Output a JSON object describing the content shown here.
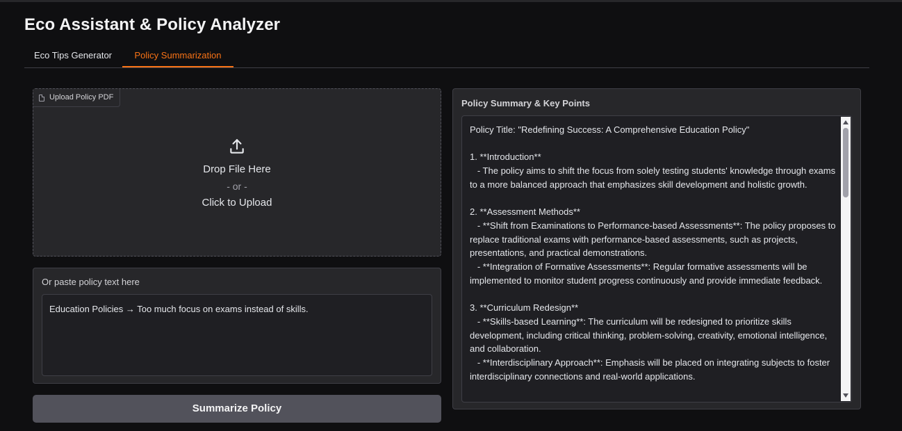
{
  "app": {
    "title": "Eco Assistant & Policy Analyzer"
  },
  "tabs": [
    {
      "label": "Eco Tips Generator",
      "active": false
    },
    {
      "label": "Policy Summarization",
      "active": true
    }
  ],
  "upload": {
    "label": "Upload Policy PDF",
    "drop_text": "Drop File Here",
    "or_text": "- or -",
    "click_text": "Click to Upload",
    "icon": "upload-icon"
  },
  "paste": {
    "label": "Or paste policy text here",
    "value": "Education Policies → Too much focus on exams instead of skills."
  },
  "summarize_button": {
    "label": "Summarize Policy"
  },
  "output": {
    "label": "Policy Summary & Key Points",
    "text": "Policy Title: \"Redefining Success: A Comprehensive Education Policy\"\n\n1. **Introduction**\n   - The policy aims to shift the focus from solely testing students' knowledge through exams to a more balanced approach that emphasizes skill development and holistic growth.\n\n2. **Assessment Methods**\n   - **Shift from Examinations to Performance-based Assessments**: The policy proposes to replace traditional exams with performance-based assessments, such as projects, presentations, and practical demonstrations.\n   - **Integration of Formative Assessments**: Regular formative assessments will be implemented to monitor student progress continuously and provide immediate feedback.\n\n3. **Curriculum Redesign**\n   - **Skills-based Learning**: The curriculum will be redesigned to prioritize skills development, including critical thinking, problem-solving, creativity, emotional intelligence, and collaboration.\n   - **Interdisciplinary Approach**: Emphasis will be placed on integrating subjects to foster interdisciplinary connections and real-world applications."
  },
  "colors": {
    "accent": "#f97316",
    "background": "#0f0f11",
    "panel": "#27272a",
    "button": "#52525b"
  }
}
